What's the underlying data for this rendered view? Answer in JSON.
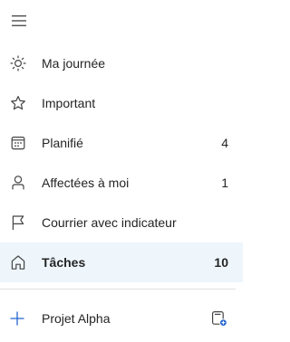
{
  "header": {
    "menu_icon": "hamburger-icon"
  },
  "nav": {
    "items": [
      {
        "label": "Ma journée",
        "count": "",
        "icon": "sun-icon"
      },
      {
        "label": "Important",
        "count": "",
        "icon": "star-icon"
      },
      {
        "label": "Planifié",
        "count": "4",
        "icon": "calendar-icon"
      },
      {
        "label": "Affectées à moi",
        "count": "1",
        "icon": "person-icon"
      },
      {
        "label": "Courrier avec indicateur",
        "count": "",
        "icon": "flag-icon"
      },
      {
        "label": "Tâches",
        "count": "10",
        "icon": "home-icon",
        "selected": true
      }
    ]
  },
  "new_list": {
    "value": "Projet Alpha",
    "add_icon": "plus-icon",
    "group_icon": "new-group-icon"
  },
  "colors": {
    "selected_background": "#eef6fc",
    "accent": "#2564cf",
    "text": "#242424"
  }
}
